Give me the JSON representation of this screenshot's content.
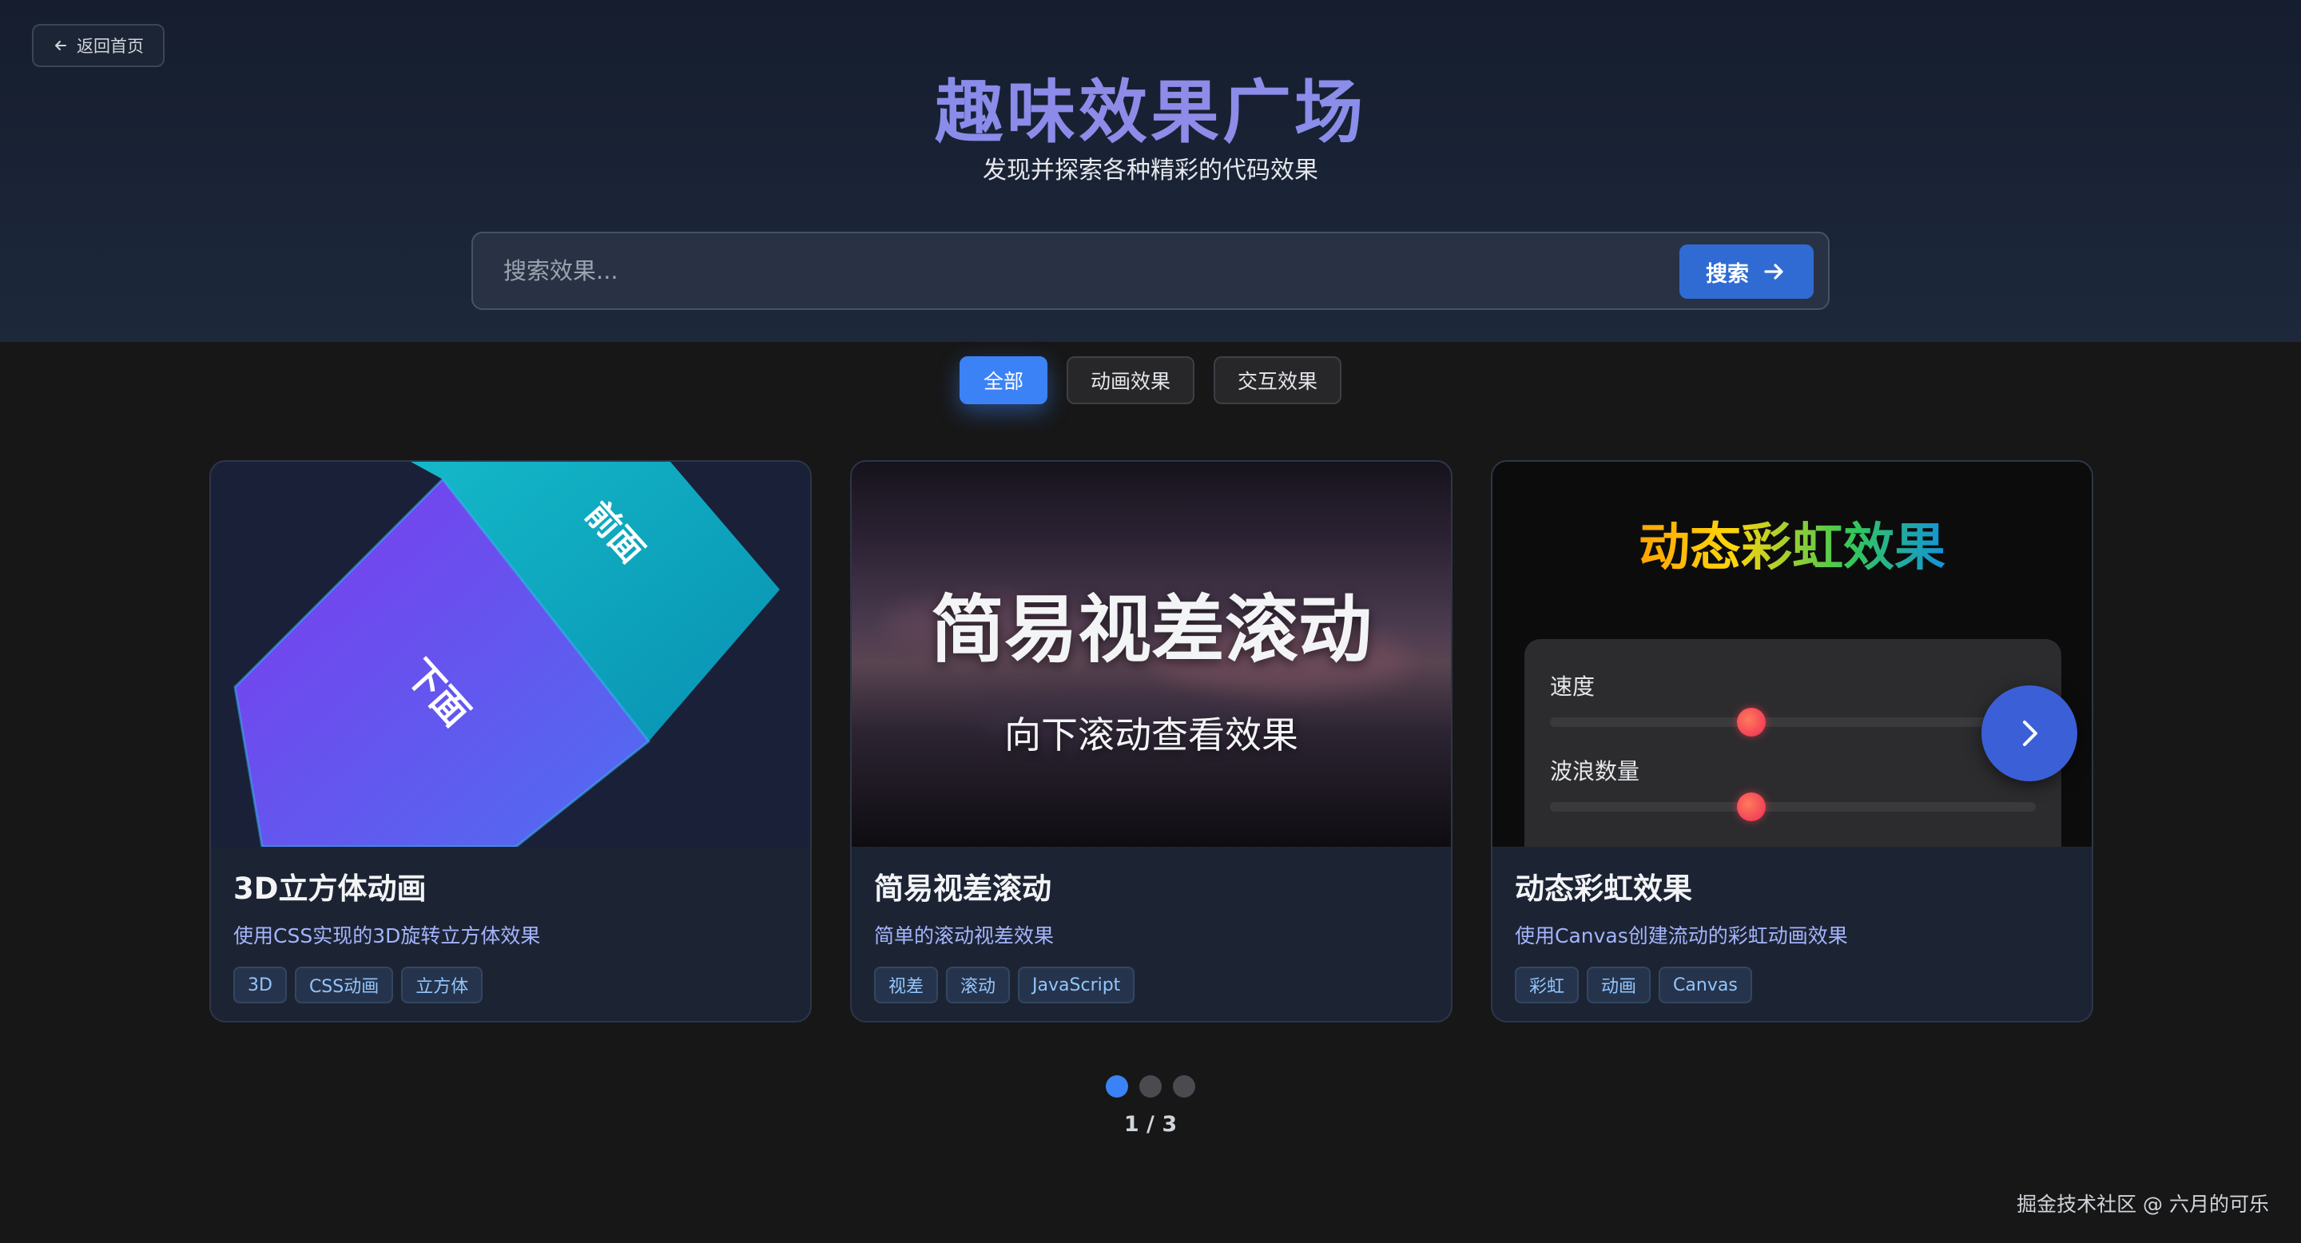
{
  "nav": {
    "back_label": "返回首页"
  },
  "hero": {
    "title": "趣味效果广场",
    "subtitle": "发现并探索各种精彩的代码效果"
  },
  "search": {
    "placeholder": "搜索效果...",
    "button_label": "搜索"
  },
  "filters": [
    {
      "label": "全部",
      "active": true
    },
    {
      "label": "动画效果",
      "active": false
    },
    {
      "label": "交互效果",
      "active": false
    }
  ],
  "cards": [
    {
      "title": "3D立方体动画",
      "description": "使用CSS实现的3D旋转立方体效果",
      "tags": [
        "3D",
        "CSS动画",
        "立方体"
      ],
      "preview": {
        "face_front": "前面",
        "face_bottom": "下面"
      }
    },
    {
      "title": "简易视差滚动",
      "description": "简单的滚动视差效果",
      "tags": [
        "视差",
        "滚动",
        "JavaScript"
      ],
      "preview": {
        "heading": "简易视差滚动",
        "subheading": "向下滚动查看效果"
      }
    },
    {
      "title": "动态彩虹效果",
      "description": "使用Canvas创建流动的彩虹动画效果",
      "tags": [
        "彩虹",
        "动画",
        "Canvas"
      ],
      "preview": {
        "heading": "动态彩虹效果",
        "control_speed": "速度",
        "control_waves": "波浪数量"
      }
    }
  ],
  "pagination": {
    "current": 1,
    "total": 3,
    "label": "1 / 3"
  },
  "footer": {
    "credit": "掘金技术社区 @ 六月的可乐"
  },
  "colors": {
    "accent": "#3b82f6",
    "search_button": "#2f6bd3",
    "background": "#171717",
    "card": "#1c2434"
  },
  "icons": {
    "back": "arrow-left-icon",
    "search_arrow": "arrow-right-icon",
    "next": "chevron-right-icon"
  }
}
